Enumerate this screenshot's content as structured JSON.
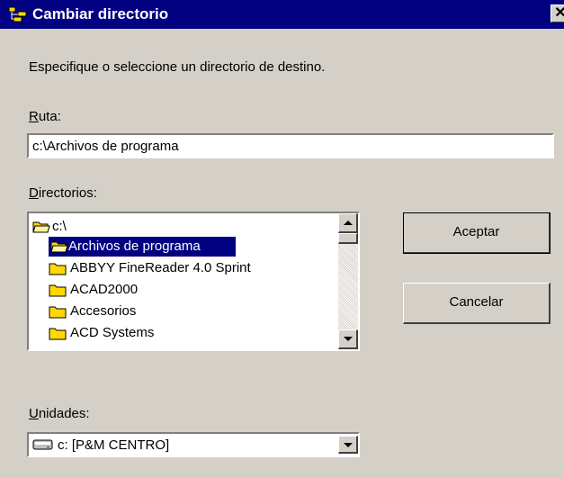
{
  "window": {
    "title": "Cambiar directorio",
    "close_glyph": "✕"
  },
  "instruction": "Especifique o seleccione un directorio de destino.",
  "path": {
    "label_access": "R",
    "label_rest": "uta:",
    "value": "c:\\Archivos de programa"
  },
  "directories": {
    "label_access": "D",
    "label_rest": "irectorios:",
    "items": [
      {
        "name": "c:\\",
        "icon": "open-folder-icon",
        "selected": false
      },
      {
        "name": "Archivos de programa",
        "icon": "open-folder-icon",
        "selected": true
      },
      {
        "name": "ABBYY FineReader 4.0 Sprint",
        "icon": "folder-icon",
        "selected": false
      },
      {
        "name": "ACAD2000",
        "icon": "folder-icon",
        "selected": false
      },
      {
        "name": "Accesorios",
        "icon": "folder-icon",
        "selected": false
      },
      {
        "name": "ACD Systems",
        "icon": "folder-icon",
        "selected": false
      }
    ]
  },
  "buttons": {
    "ok": "Aceptar",
    "cancel": "Cancelar"
  },
  "drives": {
    "label_access": "U",
    "label_rest": "nidades:",
    "selected": "c: [P&M CENTRO]",
    "icon": "hard-drive-icon"
  },
  "colors": {
    "titlebar": "#000080",
    "dialog": "#d4d0c8",
    "selection": "#000080",
    "folder": "#ffd800"
  }
}
